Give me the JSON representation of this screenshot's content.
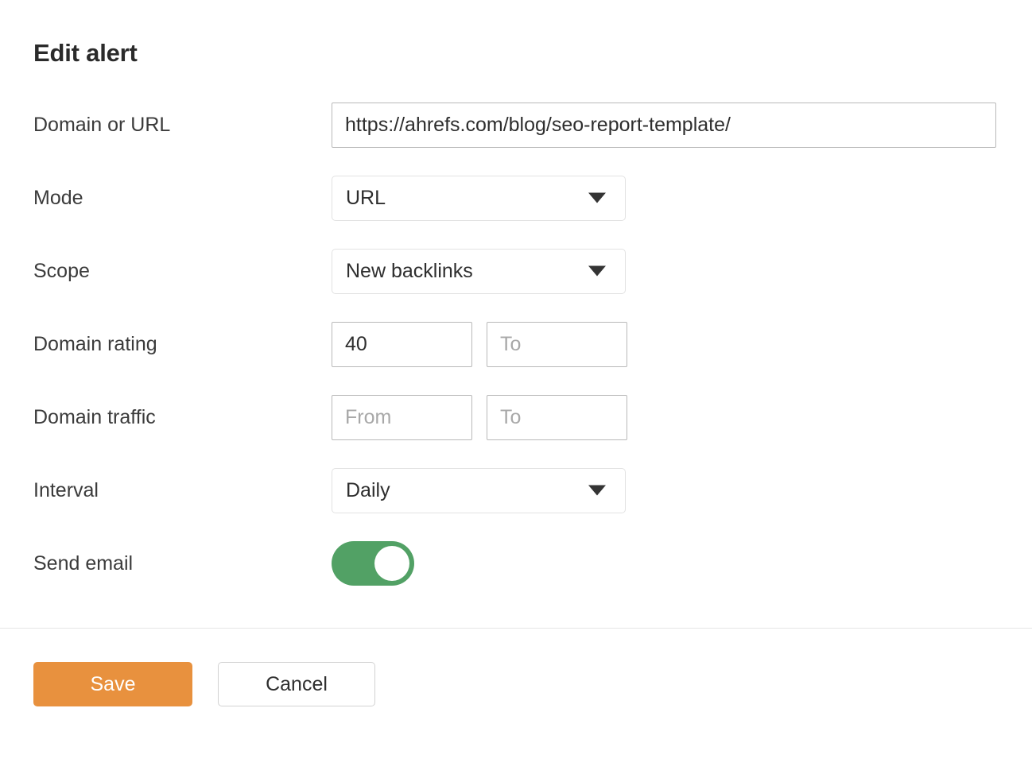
{
  "dialog": {
    "title": "Edit alert"
  },
  "form": {
    "rows": [
      {
        "label": "Domain or URL",
        "type": "text",
        "value": "https://ahrefs.com/blog/seo-report-template/",
        "placeholder": ""
      },
      {
        "label": "Mode",
        "type": "select",
        "value": "URL",
        "icon": "chevron-down-icon"
      },
      {
        "label": "Scope",
        "type": "select",
        "value": "New backlinks",
        "icon": "chevron-down-icon"
      },
      {
        "label": "Domain rating",
        "type": "range",
        "from_value": "40",
        "from_placeholder": "From",
        "to_value": "",
        "to_placeholder": "To"
      },
      {
        "label": "Domain traffic",
        "type": "range",
        "from_value": "",
        "from_placeholder": "From",
        "to_value": "",
        "to_placeholder": "To"
      },
      {
        "label": "Interval",
        "type": "select",
        "value": "Daily",
        "icon": "chevron-down-icon"
      },
      {
        "label": "Send email",
        "type": "toggle",
        "state": "on"
      }
    ]
  },
  "footer": {
    "save_label": "Save",
    "cancel_label": "Cancel"
  },
  "colors": {
    "accent_orange": "#e8913e",
    "toggle_green": "#52a165",
    "text_dark": "#2e2e2e",
    "placeholder_gray": "#a8a8a8",
    "border_light": "#e2e2e2",
    "border_input": "#b9b9b9"
  }
}
